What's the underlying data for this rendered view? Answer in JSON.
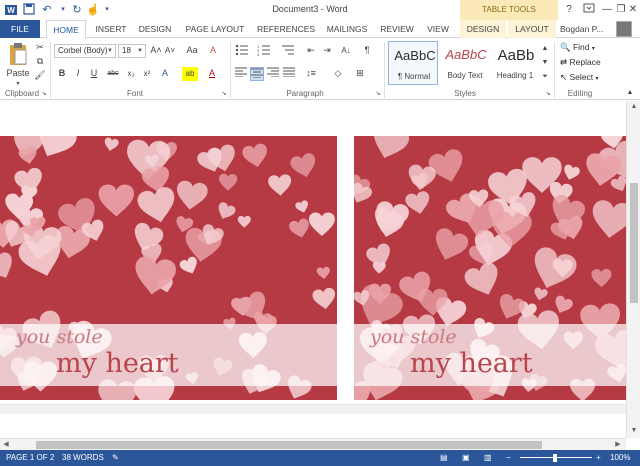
{
  "window": {
    "title": "Document3 - Word",
    "table_tools": "TABLE TOOLS",
    "help": "?",
    "minimize": "—",
    "maximize": "❐",
    "close": "✕"
  },
  "quick_access": {
    "save_icon": "💾",
    "undo_icon": "↶",
    "redo_icon": "↻",
    "touch_icon": "☝",
    "customize": "▾"
  },
  "tabs": {
    "file": "FILE",
    "home": "HOME",
    "insert": "INSERT",
    "design": "DESIGN",
    "page_layout": "PAGE LAYOUT",
    "references": "REFERENCES",
    "mailings": "MAILINGS",
    "review": "REVIEW",
    "view": "VIEW",
    "tt_design": "DESIGN",
    "tt_layout": "LAYOUT"
  },
  "user": {
    "name": "Bogdan P..."
  },
  "ribbon": {
    "clipboard": {
      "label": "Clipboard",
      "paste": "Paste"
    },
    "font": {
      "label": "Font",
      "family": "Corbel (Body)",
      "size": "18",
      "grow": "A˄",
      "shrink": "A˅",
      "case": "Aa",
      "clear": "A",
      "bold": "B",
      "italic": "I",
      "underline": "U",
      "strike": "abc",
      "sub": "x₂",
      "sup": "x²",
      "effects": "A",
      "highlight": "ab",
      "color": "A"
    },
    "paragraph": {
      "label": "Paragraph",
      "pilcrow": "¶",
      "sort": "A↓"
    },
    "styles": {
      "label": "Styles",
      "items": [
        {
          "sample": "AaBbC",
          "name": "¶ Normal"
        },
        {
          "sample": "AaBbC",
          "name": "Body Text"
        },
        {
          "sample": "AaBb",
          "name": "Heading 1"
        }
      ]
    },
    "editing": {
      "label": "Editing",
      "find": "Find",
      "replace": "Replace",
      "select": "Select"
    }
  },
  "document": {
    "cards": [
      {
        "line1": "you stole",
        "line2": "my heart"
      },
      {
        "line1": "you stole",
        "line2": "my heart"
      }
    ],
    "colors": {
      "background": "#b63a44",
      "heart_light": "#f6d3d6",
      "heart_mid": "#e9a2a8"
    }
  },
  "status": {
    "page": "PAGE 1 OF 2",
    "words": "38 WORDS",
    "zoom": "100%"
  }
}
